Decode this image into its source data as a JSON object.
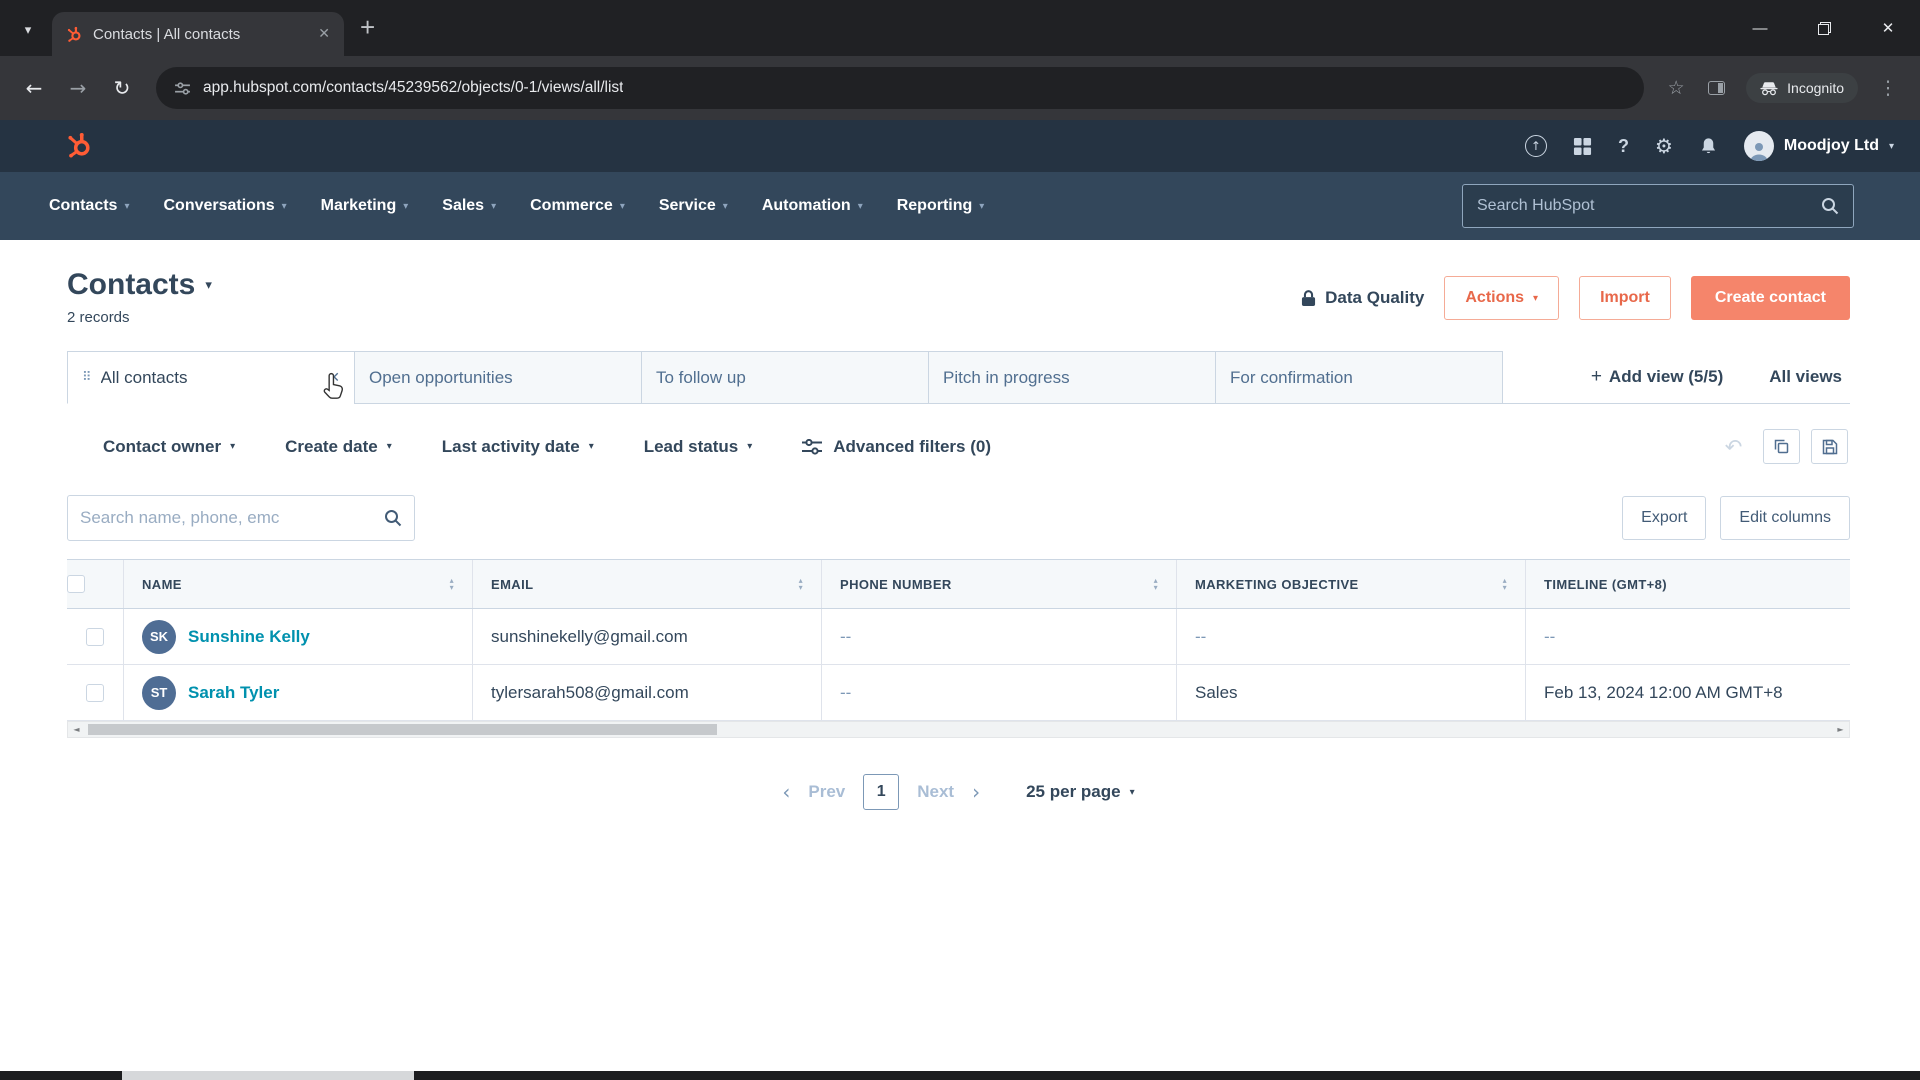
{
  "colors": {
    "hubspot_orange": "#ff5c35",
    "primary_button": "#f5856b",
    "secondary_button_text": "#e8684a",
    "link_teal": "#0091ae",
    "navy": "#33475b",
    "topbar_bg": "#253342",
    "nav_bg": "#33475b"
  },
  "browser": {
    "tab_title": "Contacts | All contacts",
    "url": "app.hubspot.com/contacts/45239562/objects/0-1/views/all/list",
    "incognito_label": "Incognito"
  },
  "hubspot": {
    "account_name": "Moodjoy Ltd",
    "search_placeholder": "Search HubSpot",
    "nav_items": [
      {
        "label": "Contacts"
      },
      {
        "label": "Conversations"
      },
      {
        "label": "Marketing"
      },
      {
        "label": "Sales"
      },
      {
        "label": "Commerce"
      },
      {
        "label": "Service"
      },
      {
        "label": "Automation"
      },
      {
        "label": "Reporting"
      }
    ]
  },
  "page": {
    "title": "Contacts",
    "record_count": "2 records",
    "data_quality_label": "Data Quality",
    "actions_label": "Actions",
    "import_label": "Import",
    "create_contact_label": "Create contact"
  },
  "views": {
    "tabs": [
      {
        "label": "All contacts"
      },
      {
        "label": "Open opportunities"
      },
      {
        "label": "To follow up"
      },
      {
        "label": "Pitch in progress"
      },
      {
        "label": "For confirmation"
      }
    ],
    "add_view_label": "Add view (5/5)",
    "all_views_label": "All views"
  },
  "filters": {
    "items": [
      {
        "label": "Contact owner"
      },
      {
        "label": "Create date"
      },
      {
        "label": "Last activity date"
      },
      {
        "label": "Lead status"
      }
    ],
    "advanced_label": "Advanced filters (0)"
  },
  "list_toolbar": {
    "search_placeholder": "Search name, phone, emc",
    "export_label": "Export",
    "edit_columns_label": "Edit columns"
  },
  "table": {
    "columns": [
      {
        "label": "NAME"
      },
      {
        "label": "EMAIL"
      },
      {
        "label": "PHONE NUMBER"
      },
      {
        "label": "MARKETING OBJECTIVE"
      },
      {
        "label": "TIMELINE (GMT+8)"
      }
    ],
    "rows": [
      {
        "initials": "SK",
        "name": "Sunshine Kelly",
        "email": "sunshinekelly@gmail.com",
        "phone": "--",
        "marketing_objective": "--",
        "timeline": "--"
      },
      {
        "initials": "ST",
        "name": "Sarah Tyler",
        "email": "tylersarah508@gmail.com",
        "phone": "--",
        "marketing_objective": "Sales",
        "timeline": "Feb 13, 2024 12:00 AM GMT+8"
      }
    ]
  },
  "pagination": {
    "prev_label": "Prev",
    "current_page": "1",
    "next_label": "Next",
    "per_page_label": "25 per page"
  }
}
